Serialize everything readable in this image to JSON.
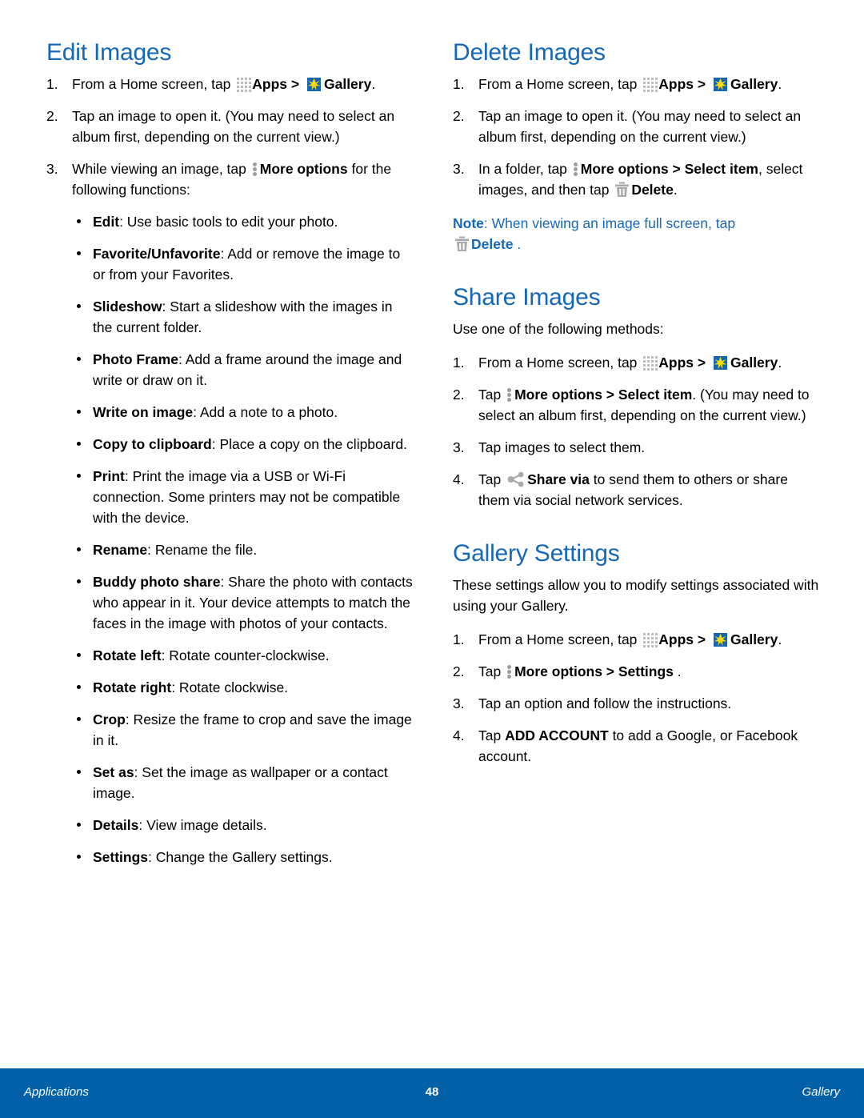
{
  "page": {
    "number": "48",
    "footer_left": "Applications",
    "footer_right": "Gallery",
    "heading_color": "#1568b8",
    "footer_color": "#0160a8"
  },
  "icons": {
    "apps": "apps-grid-icon",
    "gallery": "gallery-icon",
    "more": "more-options-icon",
    "trash": "delete-trash-icon",
    "share": "share-via-icon"
  },
  "left": {
    "heading": "Edit Images",
    "step1": {
      "num": "1.",
      "a": "From a Home screen, tap ",
      "apps": "Apps",
      "sep": " > ",
      "gallery": "Gallery",
      "end": "."
    },
    "step2": {
      "num": "2.",
      "text": "Tap an image to open it. (You may need to select an album first, depending on the current view.)"
    },
    "step3": {
      "num": "3.",
      "a": "While viewing an image, tap ",
      "more": "More options",
      "b": " for the following functions:"
    },
    "bullets": [
      {
        "term": "Edit",
        "desc": ": Use basic tools to edit your photo."
      },
      {
        "term": "Favorite/Unfavorite",
        "desc": ": Add or remove the image to or from your Favorites."
      },
      {
        "term": "Slideshow",
        "desc": ": Start a slideshow with the images in the current folder."
      },
      {
        "term": "Photo Frame",
        "desc": ": Add a frame around the image and write or draw on it."
      },
      {
        "term": "Write on image",
        "desc": ": Add a note to a photo."
      },
      {
        "term": "Copy to clipboard",
        "desc": ": Place a copy on the clipboard."
      },
      {
        "term": "Print",
        "desc": ": Print the image via a USB or Wi-Fi connection. Some printers may not be compatible with the device."
      },
      {
        "term": "Rename",
        "desc": ": Rename the file."
      },
      {
        "term": "Buddy photo share",
        "desc": ": Share the photo with contacts who appear in it. Your device attempts to match the faces in the image with photos of your contacts."
      },
      {
        "term": "Rotate left",
        "desc": ": Rotate counter-clockwise."
      },
      {
        "term": "Rotate right",
        "desc": ": Rotate clockwise."
      },
      {
        "term": "Crop",
        "desc": ": Resize the frame to crop and save the image in it."
      },
      {
        "term": "Set as",
        "desc": ": Set the image as wallpaper or a contact image."
      },
      {
        "term": "Details",
        "desc": ": View image details."
      },
      {
        "term": "Settings",
        "desc": ": Change the Gallery settings."
      }
    ]
  },
  "delete": {
    "heading": "Delete Images",
    "step1": {
      "num": "1.",
      "a": "From a Home screen, tap ",
      "apps": "Apps",
      "sep": " > ",
      "gallery": "Gallery",
      "end": "."
    },
    "step2": {
      "num": "2.",
      "text": "Tap an image to open it. (You may need to select an album first, depending on the current view.)"
    },
    "step3": {
      "num": "3.",
      "a": "In a folder, tap ",
      "more": "More options > Select item",
      "b": ", select images, and then tap ",
      "delete": "Delete",
      "end": "."
    },
    "note": {
      "label": "Note",
      "text": ": When viewing an image full screen, tap ",
      "delete": "Delete",
      "end": " ."
    }
  },
  "share": {
    "heading": "Share Images",
    "intro": "Use one of the following methods:",
    "step1": {
      "num": "1.",
      "a": "From a Home screen, tap ",
      "apps": "Apps",
      "sep": " > ",
      "gallery": "Gallery",
      "end": "."
    },
    "step2": {
      "num": "2.",
      "a": "Tap ",
      "more": "More options > Select item",
      "b": ". (You may need to select an album first, depending on the current view.)"
    },
    "step3": {
      "num": "3.",
      "text": "Tap images to select them."
    },
    "step4": {
      "num": "4.",
      "a": "Tap ",
      "sharevia": "Share via",
      "b": " to send them to others or share them via social network services."
    }
  },
  "settings": {
    "heading": "Gallery Settings",
    "intro": "These settings allow you to modify settings associated with using your Gallery.",
    "step1": {
      "num": "1.",
      "a": "From a Home screen, tap ",
      "apps": "Apps",
      "sep": " > ",
      "gallery": "Gallery",
      "end": "."
    },
    "step2": {
      "num": "2.",
      "a": "Tap ",
      "more": "More options > Settings",
      "b": " ."
    },
    "step3": {
      "num": "3.",
      "text": "Tap an option and follow the instructions."
    },
    "step4": {
      "num": "4.",
      "a": "Tap ",
      "add": "ADD ACCOUNT",
      "b": " to add a Google, or Facebook account."
    }
  }
}
